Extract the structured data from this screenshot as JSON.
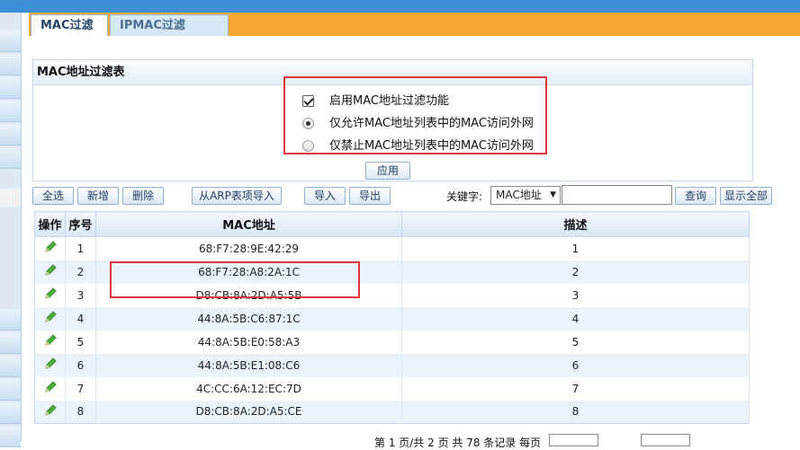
{
  "tabs": [
    {
      "label": "MAC过滤",
      "active": true
    },
    {
      "label": "IPMAC过滤",
      "active": false
    }
  ],
  "panel": {
    "title": "MAC地址过滤表",
    "options": [
      {
        "type": "checkbox",
        "checked": true,
        "label": "启用MAC地址过滤功能"
      },
      {
        "type": "radio",
        "checked": true,
        "label": "仅允许MAC地址列表中的MAC访问外网"
      },
      {
        "type": "radio",
        "checked": false,
        "label": "仅禁止MAC地址列表中的MAC访问外网"
      }
    ],
    "apply_label": "应用"
  },
  "toolbar": {
    "select_all": "全选",
    "add": "新增",
    "delete": "删除",
    "import_arp": "从ARP表项导入",
    "import": "导入",
    "export": "导出",
    "keyword_label": "关键字:",
    "keyword_field": "MAC地址",
    "keyword_value": "",
    "search": "查询",
    "show_all": "显示全部"
  },
  "table": {
    "headers": [
      "操作",
      "序号",
      "MAC地址",
      "描述"
    ],
    "rows": [
      {
        "index": "1",
        "mac": "68:F7:28:9E:42:29",
        "desc": "1"
      },
      {
        "index": "2",
        "mac": "68:F7:28:A8:2A:1C",
        "desc": "2"
      },
      {
        "index": "3",
        "mac": "D8:CB:8A:2D:A5:5B",
        "desc": "3"
      },
      {
        "index": "4",
        "mac": "44:8A:5B:C6:87:1C",
        "desc": "4"
      },
      {
        "index": "5",
        "mac": "44:8A:5B:E0:58:A3",
        "desc": "5"
      },
      {
        "index": "6",
        "mac": "44:8A:5B:E1:08:C6",
        "desc": "6"
      },
      {
        "index": "7",
        "mac": "4C:CC:6A:12:EC:7D",
        "desc": "7"
      },
      {
        "index": "8",
        "mac": "D8:CB:8A:2D:A5:CE",
        "desc": "8"
      }
    ]
  },
  "pager": {
    "summary": "第 1 页/共 2 页 共 78 条记录 每页"
  },
  "colors": {
    "accent_orange": "#f7a833",
    "header_blue": "#3b8fd6",
    "highlight_red": "#e0343c",
    "edit_icon_green": "#3a9a2a"
  }
}
